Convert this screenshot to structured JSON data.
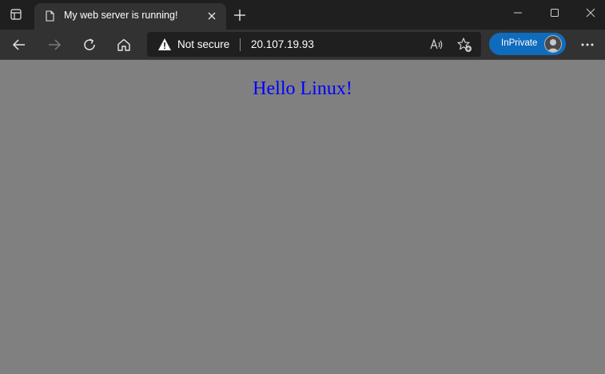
{
  "browser": {
    "tab": {
      "title": "My web server is running!"
    },
    "address_bar": {
      "security_label": "Not secure",
      "url": "20.107.19.93"
    },
    "profile": {
      "label": "InPrivate"
    },
    "icons": {
      "tab_actions": "tab-actions-icon",
      "favicon": "page-icon",
      "tab_close": "close-icon",
      "new_tab": "plus-icon",
      "minimize": "minimize-icon",
      "maximize": "maximize-icon",
      "window_close": "close-icon",
      "back": "arrow-left-icon",
      "forward": "arrow-right-icon",
      "refresh": "refresh-icon",
      "home": "home-icon",
      "warning": "warning-icon",
      "read_aloud": "read-aloud-icon",
      "add_favorite": "star-plus-icon",
      "menu": "more-icon"
    },
    "colors": {
      "title_bar": "#1f1f1f",
      "toolbar": "#323232",
      "inprivate": "#0f6cbd"
    }
  },
  "page": {
    "heading": "Hello Linux!",
    "background_color": "#808080",
    "text_color": "#0000ff"
  }
}
